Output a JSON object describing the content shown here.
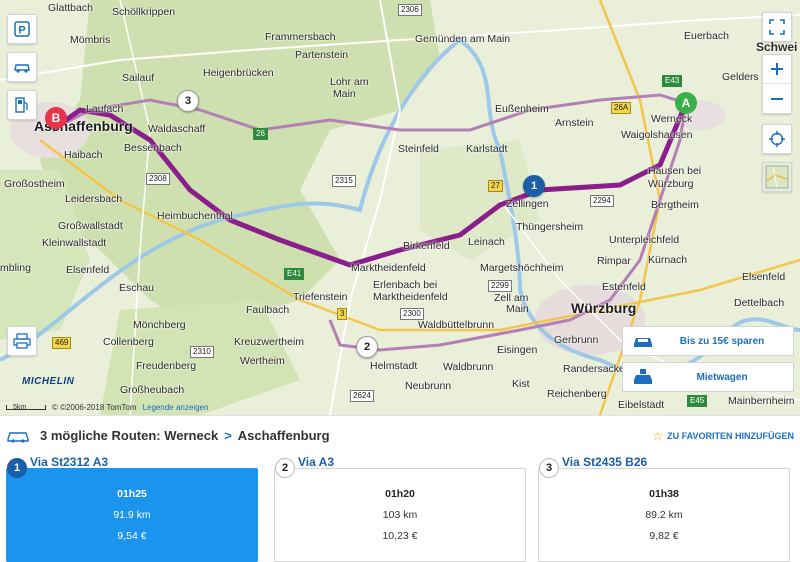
{
  "map": {
    "towns": [
      {
        "name": "Glattbach",
        "cls": ""
      },
      {
        "name": "Schöllkrippen",
        "cls": ""
      },
      {
        "name": "Mömbris",
        "cls": ""
      },
      {
        "name": "Frammersbach",
        "cls": ""
      },
      {
        "name": "Partenstein",
        "cls": ""
      },
      {
        "name": "Sailauf",
        "cls": ""
      },
      {
        "name": "Heigenbrücken",
        "cls": ""
      },
      {
        "name": "Lohr am",
        "cls": ""
      },
      {
        "name": "Main",
        "cls": ""
      },
      {
        "name": "Gemünden am Main",
        "cls": ""
      },
      {
        "name": "Euerbach",
        "cls": ""
      },
      {
        "name": "Schwei",
        "cls": "mid"
      },
      {
        "name": "Gelders",
        "cls": ""
      },
      {
        "name": "Aschaffenburg",
        "cls": "big"
      },
      {
        "name": "Laufach",
        "cls": ""
      },
      {
        "name": "Waldaschaff",
        "cls": ""
      },
      {
        "name": "Eußenheim",
        "cls": ""
      },
      {
        "name": "Arnstein",
        "cls": ""
      },
      {
        "name": "Werneck",
        "cls": ""
      },
      {
        "name": "Waigolshausen",
        "cls": ""
      },
      {
        "name": "Haibach",
        "cls": ""
      },
      {
        "name": "Bessenbach",
        "cls": ""
      },
      {
        "name": "Steinfeld",
        "cls": ""
      },
      {
        "name": "Karlstadt",
        "cls": ""
      },
      {
        "name": "Großostheim",
        "cls": ""
      },
      {
        "name": "Hausen bei",
        "cls": ""
      },
      {
        "name": "Würzburg",
        "cls": ""
      },
      {
        "name": "Leidersbach",
        "cls": ""
      },
      {
        "name": "Zellingen",
        "cls": ""
      },
      {
        "name": "Bergtheim",
        "cls": ""
      },
      {
        "name": "Großwallstadt",
        "cls": ""
      },
      {
        "name": "Kleinwallstadt",
        "cls": ""
      },
      {
        "name": "Heimbuchenthal",
        "cls": ""
      },
      {
        "name": "Thüngersheim",
        "cls": ""
      },
      {
        "name": "Leinach",
        "cls": ""
      },
      {
        "name": "Birkenfeld",
        "cls": ""
      },
      {
        "name": "Unterpleichfeld",
        "cls": ""
      },
      {
        "name": "Elsenfeld",
        "cls": ""
      },
      {
        "name": "Marktheidenfeld",
        "cls": ""
      },
      {
        "name": "Margetshöchheim",
        "cls": ""
      },
      {
        "name": "Rimpar",
        "cls": ""
      },
      {
        "name": "Kürnach",
        "cls": ""
      },
      {
        "name": "Eschau",
        "cls": ""
      },
      {
        "name": "Erlenbach bei",
        "cls": ""
      },
      {
        "name": "Marktheidenfeld",
        "cls": ""
      },
      {
        "name": "Zell am",
        "cls": ""
      },
      {
        "name": "Main",
        "cls": ""
      },
      {
        "name": "Triefenstein",
        "cls": ""
      },
      {
        "name": "Estenfeld",
        "cls": ""
      },
      {
        "name": "Würzburg",
        "cls": "big"
      },
      {
        "name": "Mönchberg",
        "cls": ""
      },
      {
        "name": "Faulbach",
        "cls": ""
      },
      {
        "name": "Waldbüttelbrunn",
        "cls": ""
      },
      {
        "name": "Dettelbach",
        "cls": ""
      },
      {
        "name": "Collenberg",
        "cls": ""
      },
      {
        "name": "Kreuzwertheim",
        "cls": ""
      },
      {
        "name": "Gerbrunn",
        "cls": ""
      },
      {
        "name": "Wertheim",
        "cls": ""
      },
      {
        "name": "Eisingen",
        "cls": ""
      },
      {
        "name": "Freudenberg",
        "cls": ""
      },
      {
        "name": "Helmstadt",
        "cls": ""
      },
      {
        "name": "Waldbrunn",
        "cls": ""
      },
      {
        "name": "Randersacker",
        "cls": ""
      },
      {
        "name": "Kist",
        "cls": ""
      },
      {
        "name": "Reichenberg",
        "cls": ""
      },
      {
        "name": "Neubrunn",
        "cls": ""
      },
      {
        "name": "Eibelstadt",
        "cls": ""
      },
      {
        "name": "Mainbernheim",
        "cls": ""
      },
      {
        "name": "Großheubach",
        "cls": ""
      },
      {
        "name": "mbling",
        "cls": ""
      },
      {
        "name": "Elsenfeld",
        "cls": ""
      },
      {
        "name": "Dettelbach",
        "cls": ""
      }
    ],
    "road_numbers": [
      "2306",
      "26",
      "2308",
      "26A",
      "27",
      "2294",
      "2315",
      "2299",
      "E41",
      "3",
      "2310",
      "2300",
      "2624",
      "469",
      "E45",
      "E43"
    ],
    "route_markers": [
      "1",
      "2",
      "3"
    ],
    "start_pin": "A",
    "end_pin": "B",
    "promo": [
      {
        "label": "Bis zu 15€ sparen"
      },
      {
        "label": "Mietwagen"
      }
    ],
    "scale": "5km",
    "copyright": "© ©2006-2018 TomTom",
    "legend_link": "Legende anzeigen",
    "brand": "MICHELIN",
    "route_color": "#8a1e8a"
  },
  "panel": {
    "summary_prefix": "3 mögliche Routen: Werneck",
    "summary_sep": ">",
    "summary_dest": "Aschaffenburg",
    "favorite": "ZU FAVORITEN HINZUFÜGEN",
    "routes": [
      {
        "num": "1",
        "title": "Via St2312 A3",
        "duration": "01h25",
        "distance": "91.9 km",
        "cost": "9,54 €",
        "selected": true
      },
      {
        "num": "2",
        "title": "Via A3",
        "duration": "01h20",
        "distance": "103 km",
        "cost": "10,23 €",
        "selected": false
      },
      {
        "num": "3",
        "title": "Via St2435 B26",
        "duration": "01h38",
        "distance": "89.2 km",
        "cost": "9,82 €",
        "selected": false
      }
    ],
    "accent": "#1a94ec"
  }
}
